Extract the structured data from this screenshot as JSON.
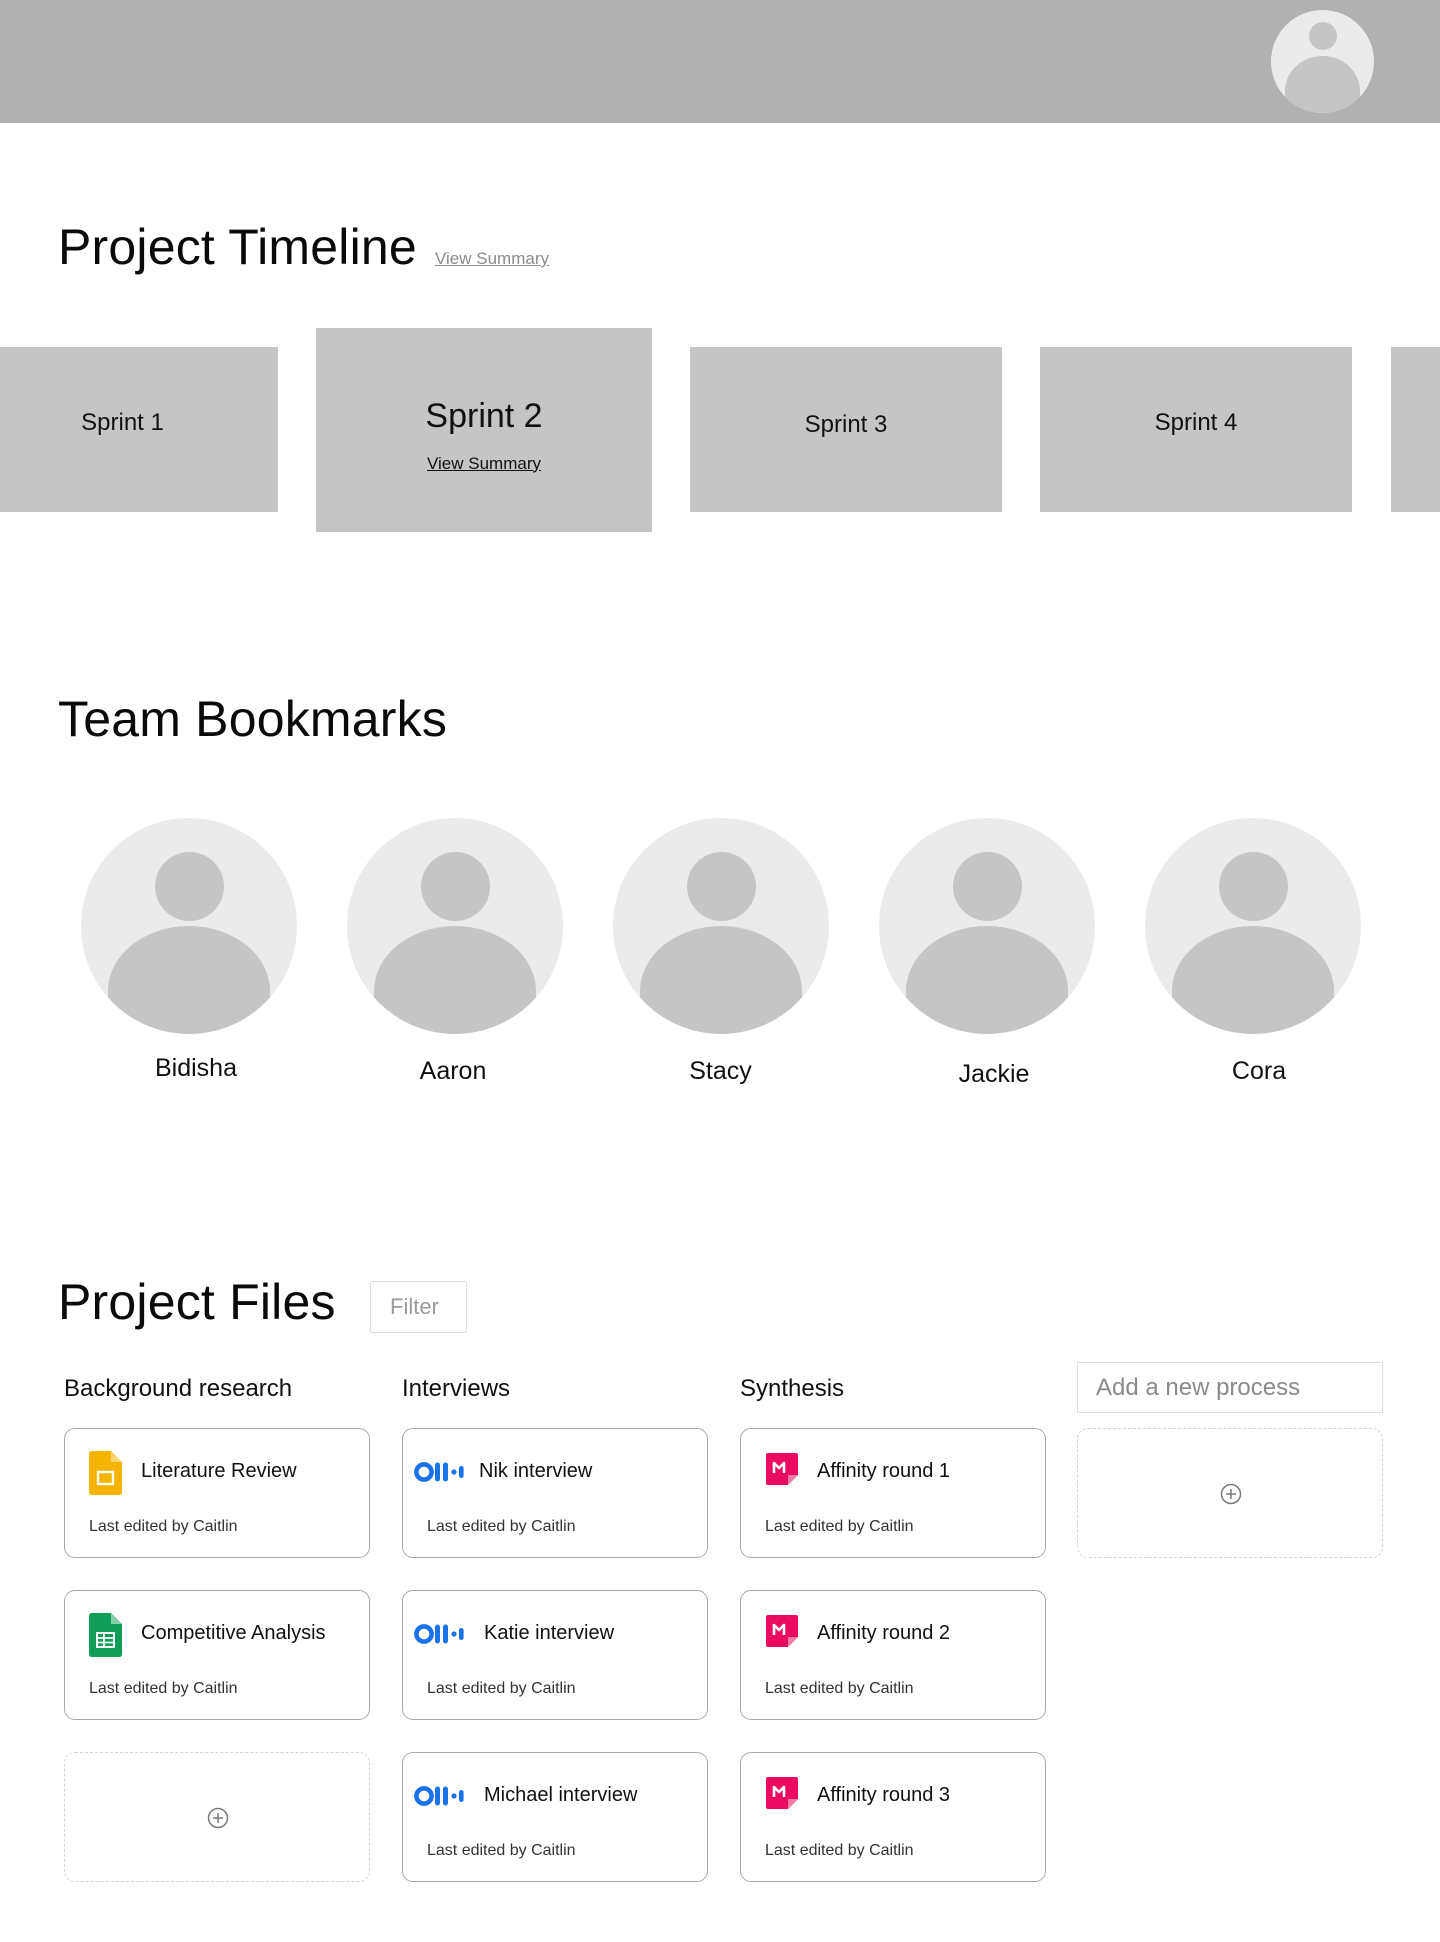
{
  "header": {
    "avatar_icon": "user-avatar-icon"
  },
  "timeline": {
    "title": "Project Timeline",
    "summary_link": "View Summary",
    "sprints": [
      {
        "label": "Sprint 1"
      },
      {
        "label": "Sprint 2",
        "summary_link": "View Summary",
        "active": true
      },
      {
        "label": "Sprint 3"
      },
      {
        "label": "Sprint 4"
      }
    ]
  },
  "team": {
    "title": "Team Bookmarks",
    "members": [
      {
        "name": "Bidisha"
      },
      {
        "name": "Aaron"
      },
      {
        "name": "Stacy"
      },
      {
        "name": "Jackie"
      },
      {
        "name": "Cora"
      }
    ]
  },
  "files": {
    "title": "Project Files",
    "filter_label": "Filter",
    "new_process_placeholder": "Add a new process",
    "columns": [
      {
        "heading": "Background research",
        "cards": [
          {
            "title": "Literature Review",
            "meta": "Last edited by Caitlin",
            "icon": "google-slides-icon"
          },
          {
            "title": "Competitive Analysis",
            "meta": "Last edited by Caitlin",
            "icon": "google-sheets-icon"
          }
        ]
      },
      {
        "heading": "Interviews",
        "cards": [
          {
            "title": "Nik interview",
            "meta": "Last edited by Caitlin",
            "icon": "otter-icon"
          },
          {
            "title": "Katie interview",
            "meta": "Last edited by Caitlin",
            "icon": "otter-icon"
          },
          {
            "title": "Michael interview",
            "meta": "Last edited by Caitlin",
            "icon": "otter-icon"
          }
        ]
      },
      {
        "heading": "Synthesis",
        "cards": [
          {
            "title": "Affinity round 1",
            "meta": "Last edited by Caitlin",
            "icon": "miro-icon"
          },
          {
            "title": "Affinity round 2",
            "meta": "Last edited by Caitlin",
            "icon": "miro-icon"
          },
          {
            "title": "Affinity round 3",
            "meta": "Last edited by Caitlin",
            "icon": "miro-icon"
          }
        ]
      }
    ]
  },
  "colors": {
    "header_bg": "#b1b1b1",
    "sprint_bg": "#c5c5c5",
    "avatar_bg": "#ebebeb",
    "avatar_fg": "#c5c5c5",
    "slides_yellow": "#f4b400",
    "sheets_green": "#0f9d58",
    "otter_blue": "#1a73e8",
    "miro_pink": "#ea0b60"
  }
}
